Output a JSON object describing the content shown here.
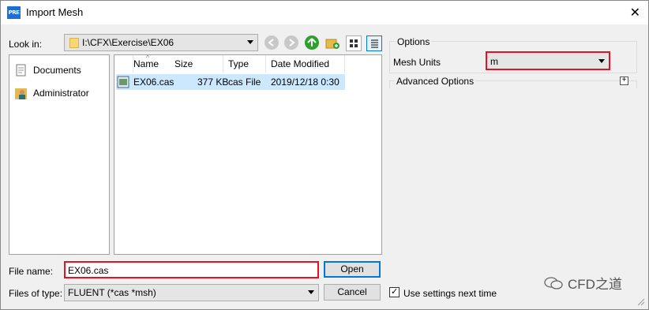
{
  "window": {
    "title": "Import Mesh",
    "app_badge": "PRE",
    "close_glyph": "✕"
  },
  "look_in": {
    "label": "Look in:",
    "path": "I:\\CFX\\Exercise\\EX06"
  },
  "toolbar_icons": [
    "back-icon",
    "forward-icon",
    "up-icon",
    "new-folder-icon",
    "list-view-icon",
    "detail-view-icon"
  ],
  "places": [
    {
      "label": "Documents",
      "icon": "documents-icon"
    },
    {
      "label": "Administrator",
      "icon": "user-folder-icon"
    }
  ],
  "file_list": {
    "columns": [
      "Name",
      "Size",
      "Type",
      "Date Modified"
    ],
    "rows": [
      {
        "name": "EX06.cas",
        "size": "377 KB",
        "type": "cas File",
        "date": "2019/12/18 0:30",
        "selected": true
      }
    ]
  },
  "file_name": {
    "label": "File name:",
    "value": "EX06.cas"
  },
  "files_of_type": {
    "label": "Files of type:",
    "value": "FLUENT (*cas *msh)"
  },
  "buttons": {
    "open": "Open",
    "cancel": "Cancel"
  },
  "options": {
    "title": "Options",
    "mesh_units_label": "Mesh Units",
    "mesh_units_value": "m",
    "advanced_label": "Advanced Options",
    "expand_glyph": "+"
  },
  "use_settings": {
    "label": "Use settings next time",
    "checked": true,
    "check_glyph": "✓"
  },
  "watermark": "CFD之道",
  "colors": {
    "highlight_border": "#e81123",
    "selection": "#cce8ff",
    "default_button": "#0078d7"
  }
}
